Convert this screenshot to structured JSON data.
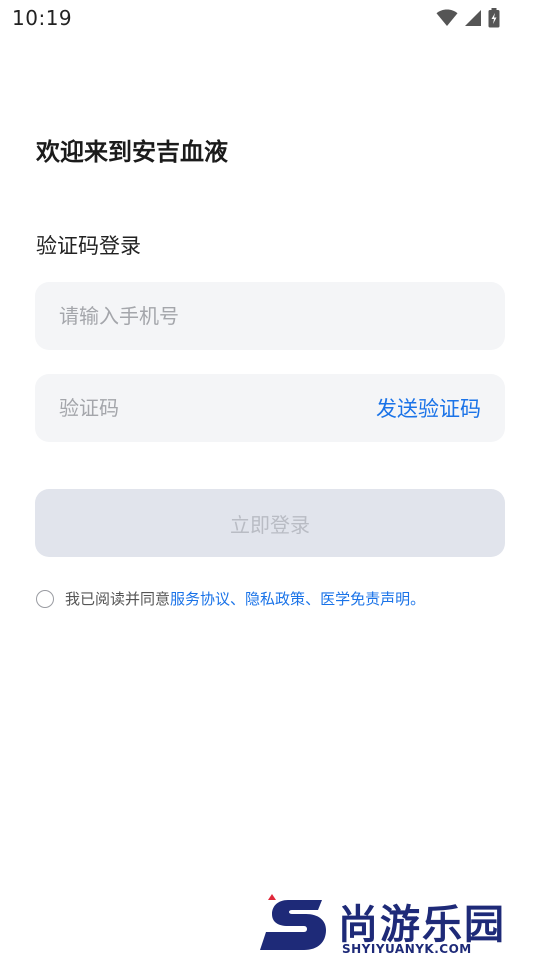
{
  "status_bar": {
    "time": "10:19",
    "icons": [
      "wifi-icon",
      "signal-icon",
      "battery-charging-icon"
    ]
  },
  "welcome_title": "欢迎来到安吉血液",
  "login_mode_title": "验证码登录",
  "phone_field": {
    "placeholder": "请输入手机号",
    "value": ""
  },
  "code_field": {
    "placeholder": "验证码",
    "value": ""
  },
  "send_code_label": "发送验证码",
  "login_button_label": "立即登录",
  "agreement": {
    "prefix": "我已阅读并同意",
    "service_link": "服务协议",
    "sep1": "、",
    "privacy_link": "隐私政策",
    "sep2": "、",
    "disclaimer_link": "医学免责声明",
    "suffix": "。"
  },
  "watermark": {
    "text": "尚游乐园",
    "url": "SHYIYUANYK.COM"
  },
  "colors": {
    "accent": "#1a73e8",
    "field_bg": "#f4f5f7",
    "button_disabled_bg": "#e1e4ec",
    "button_disabled_text": "#b9bcc4",
    "watermark": "#1e2a78"
  }
}
